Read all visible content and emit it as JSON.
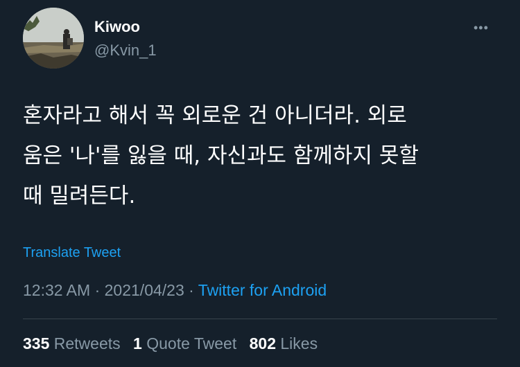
{
  "user": {
    "display_name": "Kiwoo",
    "handle": "@Kvin_1",
    "avatar_icon": "profile-photo"
  },
  "more_icon": "more-options-icon",
  "tweet": {
    "lines": [
      "혼자라고 해서 꼭 외로운 건 아니더라. 외로",
      "움은 '나'를 잃을 때, 자신과도 함께하지 못할",
      "때 밀려든다."
    ]
  },
  "translate_label": "Translate Tweet",
  "meta": {
    "time": "12:32 AM",
    "sep1": " · ",
    "date": "2021/04/23",
    "sep2": " · ",
    "source": "Twitter for Android"
  },
  "stats": {
    "retweets_count": "335",
    "retweets_label": "Retweets",
    "quotes_count": "1",
    "quotes_label": "Quote Tweet",
    "likes_count": "802",
    "likes_label": "Likes"
  },
  "colors": {
    "background": "#15202b",
    "accent": "#1da1f2",
    "secondary_text": "#8899a6",
    "divider": "#38444d"
  }
}
